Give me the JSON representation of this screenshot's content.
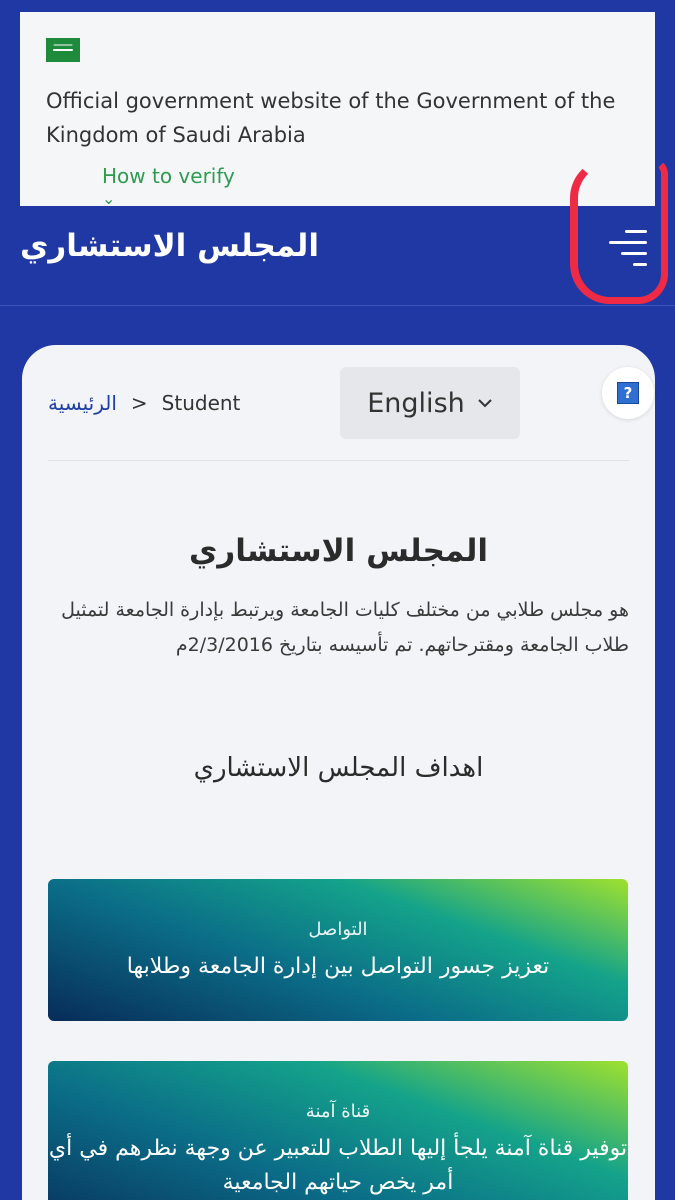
{
  "gov_banner": {
    "text": "Official government website of the Government of the Kingdom of Saudi Arabia",
    "verify_link": "How to verify",
    "flag_color": "#1e8a3c"
  },
  "header": {
    "title": "المجلس الاستشاري",
    "background": "#2038a4"
  },
  "breadcrumb": {
    "home": "الرئيسية",
    "separator": ">",
    "current": "Student"
  },
  "language_select": {
    "selected": "English"
  },
  "help_button": {
    "glyph": "?",
    "icon": "help-icon"
  },
  "main": {
    "title": "المجلس الاستشاري",
    "intro": "هو مجلس طلابي من مختلف كليات الجامعة ويرتبط بإدارة الجامعة لتمثيل طلاب الجامعة ومقترحاتهم. تم تأسيسه بتاريخ 2/3/2016م",
    "goals_title": "اهداف المجلس الاستشاري"
  },
  "goals": [
    {
      "title": "التواصل",
      "text": "تعزيز جسور التواصل بين إدارة الجامعة وطلابها"
    },
    {
      "title": "قناة آمنة",
      "text": "توفير قناة آمنة يلجأ إليها الطلاب للتعبير عن وجهة نظرهم في أي أمر يخص حياتهم الجامعية"
    }
  ],
  "colors": {
    "accent_blue": "#2038a4",
    "verify_green": "#2f9b50",
    "annotation_red": "#ef2a45"
  }
}
